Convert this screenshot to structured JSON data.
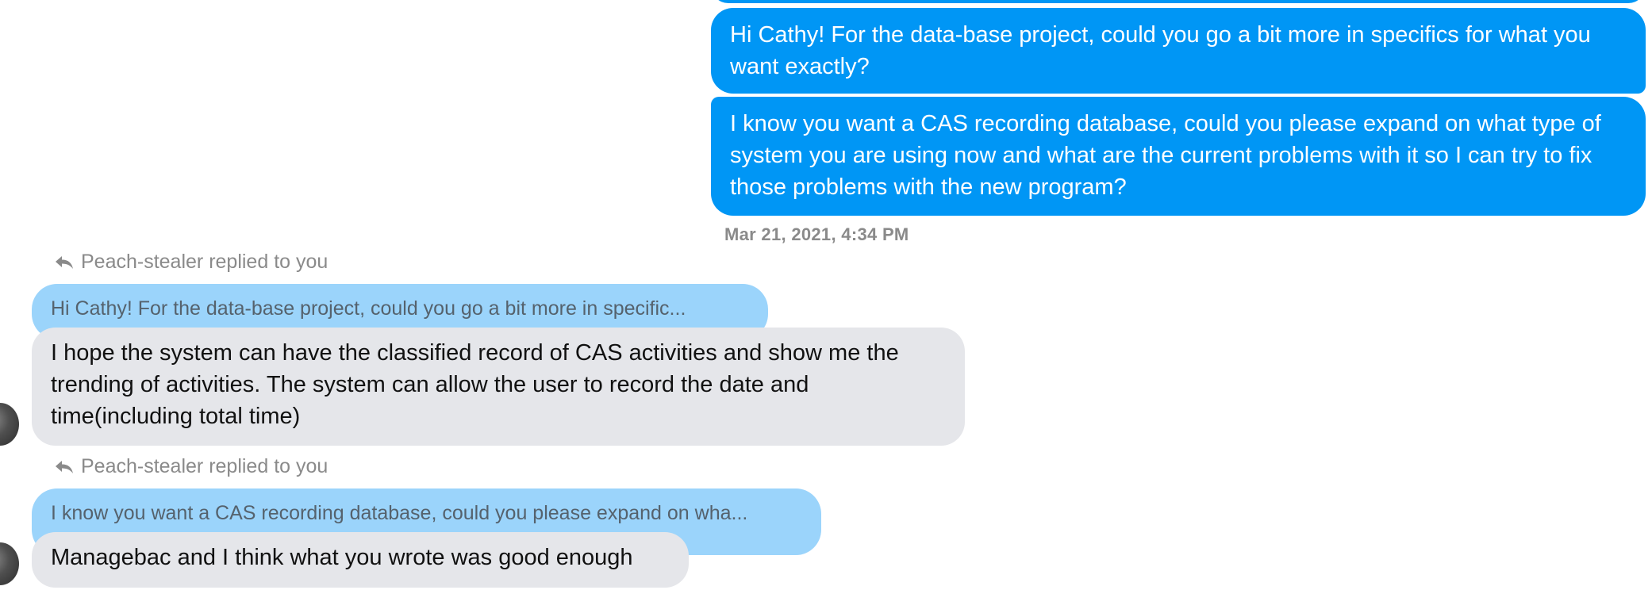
{
  "conversation": {
    "outgoing": [
      {
        "text": "Hi Cathy! For the data-base project, could you go a bit more in specifics for what you want exactly?"
      },
      {
        "text": "I know you want a CAS recording database, could you please expand on what type of system you are using now and what are the current problems with it so I can try to fix those problems with the new program?"
      }
    ],
    "timestamp": "Mar 21, 2021, 4:34 PM",
    "replies": [
      {
        "header": "Peach-stealer replied to you",
        "quote": "Hi Cathy! For the data-base project, could you go a bit more in specific...",
        "text": "I hope the system can have the classified record of CAS activities and show me the trending of activities. The system can allow the user to record the date and time(including total time)"
      },
      {
        "header": "Peach-stealer replied to you",
        "quote": "I know you want a CAS recording database, could you please expand on wha...",
        "text": "Managebac and I think what you wrote was good enough"
      }
    ]
  },
  "colors": {
    "outgoing_bubble": "#0096f5",
    "quote_bubble": "#9bd4fb",
    "incoming_bubble": "#e5e6ea",
    "meta_text": "#8a8a8a"
  },
  "icons": {
    "reply": "reply-arrow-icon",
    "avatar": "avatar-photo"
  }
}
